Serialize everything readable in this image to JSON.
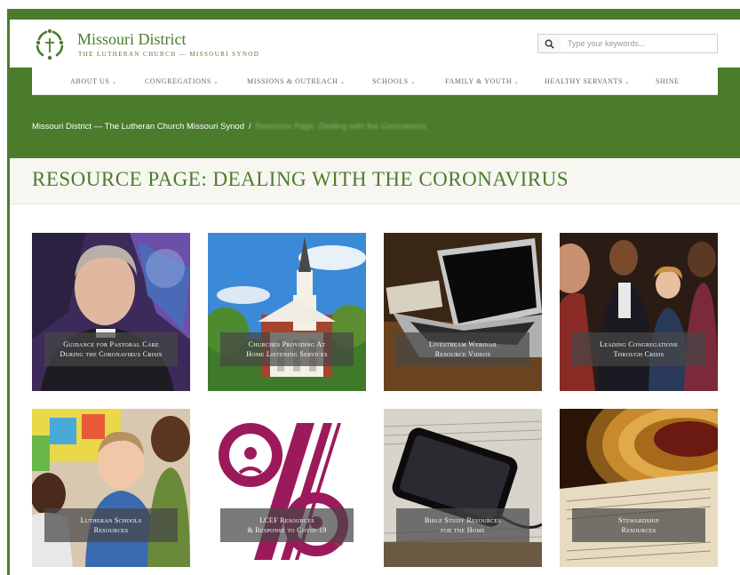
{
  "brand": {
    "name": "Missouri District",
    "subtitle": "THE LUTHERAN CHURCH — MISSOURI SYNOD"
  },
  "search": {
    "placeholder": "Type your keywords...",
    "icon": "search-icon"
  },
  "nav": {
    "items": [
      {
        "label": "ABOUT US",
        "dropdown": true
      },
      {
        "label": "CONGREGATIONS",
        "dropdown": true
      },
      {
        "label": "MISSIONS & OUTREACH",
        "dropdown": true
      },
      {
        "label": "SCHOOLS",
        "dropdown": true
      },
      {
        "label": "FAMILY & YOUTH",
        "dropdown": true
      },
      {
        "label": "HEALTHY SERVANTS",
        "dropdown": true
      },
      {
        "label": "SHINE",
        "dropdown": false
      }
    ],
    "chevron": "⌄"
  },
  "breadcrumb": {
    "home": "Missouri District — The Lutheran Church Missouri Synod",
    "separator": "/",
    "current": "Resource Page: Dealing with the Coronavirus"
  },
  "page": {
    "title": "RESOURCE PAGE: DEALING WITH THE CORONAVIRUS"
  },
  "cards": [
    {
      "line1": "Guidance for Pastoral Care",
      "line2": "During the Coronavirus Crisis"
    },
    {
      "line1": "Churches Providing At",
      "line2": "Home Listening Services"
    },
    {
      "line1": "Livestream Webinar",
      "line2": "Resource Videos"
    },
    {
      "line1": "Leading Congregations",
      "line2": "Through Crisis"
    },
    {
      "line1": "Lutheran Schools",
      "line2": "Resources"
    },
    {
      "line1": "LCEF Resources",
      "line2": "& Response to Covid-19"
    },
    {
      "line1": "Bible Study Resources",
      "line2": "for the Home"
    },
    {
      "line1": "Stewardship",
      "line2": "Resources"
    }
  ],
  "colors": {
    "brand_green": "#4a7c2c",
    "lcef_magenta": "#9c1a5c",
    "title_band": "#f7f6f1"
  }
}
